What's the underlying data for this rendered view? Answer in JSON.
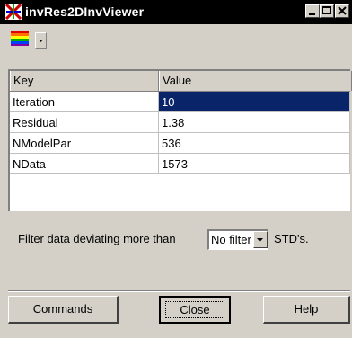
{
  "window": {
    "title": "invRes2DInvViewer"
  },
  "toolbar": {
    "colormap_button": "colormap-icon"
  },
  "table": {
    "columns": [
      "Key",
      "Value"
    ],
    "rows": [
      {
        "key": "Iteration",
        "value": "10",
        "selected": true
      },
      {
        "key": "Residual",
        "value": "1.38"
      },
      {
        "key": "NModelPar",
        "value": "536"
      },
      {
        "key": "NData",
        "value": "1573"
      }
    ]
  },
  "filter": {
    "label": "Filter data deviating more than",
    "selected": "No filter",
    "suffix": "STD's."
  },
  "buttons": {
    "commands": "Commands",
    "close": "Close",
    "help": "Help"
  },
  "colors": {
    "titlebar": "#000000",
    "face": "#d4d0c8",
    "selection": "#0a246a"
  }
}
